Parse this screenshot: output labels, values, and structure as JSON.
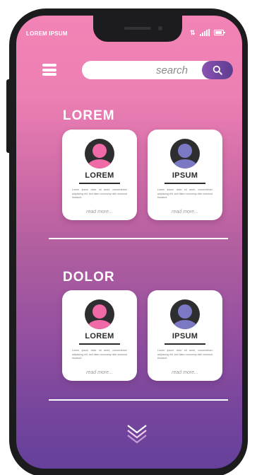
{
  "status_bar": {
    "app_label": "LOREM IPSUM",
    "icons": [
      "data-arrows-icon",
      "signal-icon",
      "battery-icon"
    ]
  },
  "header": {
    "menu_icon": "hamburger-menu-icon",
    "search_placeholder": "search",
    "search_icon": "magnifier-icon"
  },
  "sections": [
    {
      "title": "LOREM",
      "cards": [
        {
          "name": "LOREM",
          "avatar_color": "#f06aa8",
          "description": "Lorem ipsum dolor sit amet, consectetuer adipiscing elit, sed diam nonummy nibh euismod tincidunt.",
          "link": "read more..."
        },
        {
          "name": "IPSUM",
          "avatar_color": "#7b78c4",
          "description": "Lorem ipsum dolor sit amet, consectetuer adipiscing elit, sed diam nonummy nibh euismod tincidunt.",
          "link": "read more..."
        }
      ]
    },
    {
      "title": "DOLOR",
      "cards": [
        {
          "name": "LOREM",
          "avatar_color": "#f06aa8",
          "description": "Lorem ipsum dolor sit amet, consectetuer adipiscing elit, sed diam nonummy nibh euismod tincidunt.",
          "link": "read more..."
        },
        {
          "name": "IPSUM",
          "avatar_color": "#7b78c4",
          "description": "Lorem ipsum dolor sit amet, consectetuer adipiscing elit, sed diam nonummy nibh euismod tincidunt.",
          "link": "read more..."
        }
      ]
    }
  ],
  "footer": {
    "scroll_icon": "chevron-double-down-icon"
  },
  "colors": {
    "gradient_top": "#f283b5",
    "gradient_bottom": "#65409a",
    "search_button": "#6b4499",
    "card_text": "#2b2b2b"
  }
}
